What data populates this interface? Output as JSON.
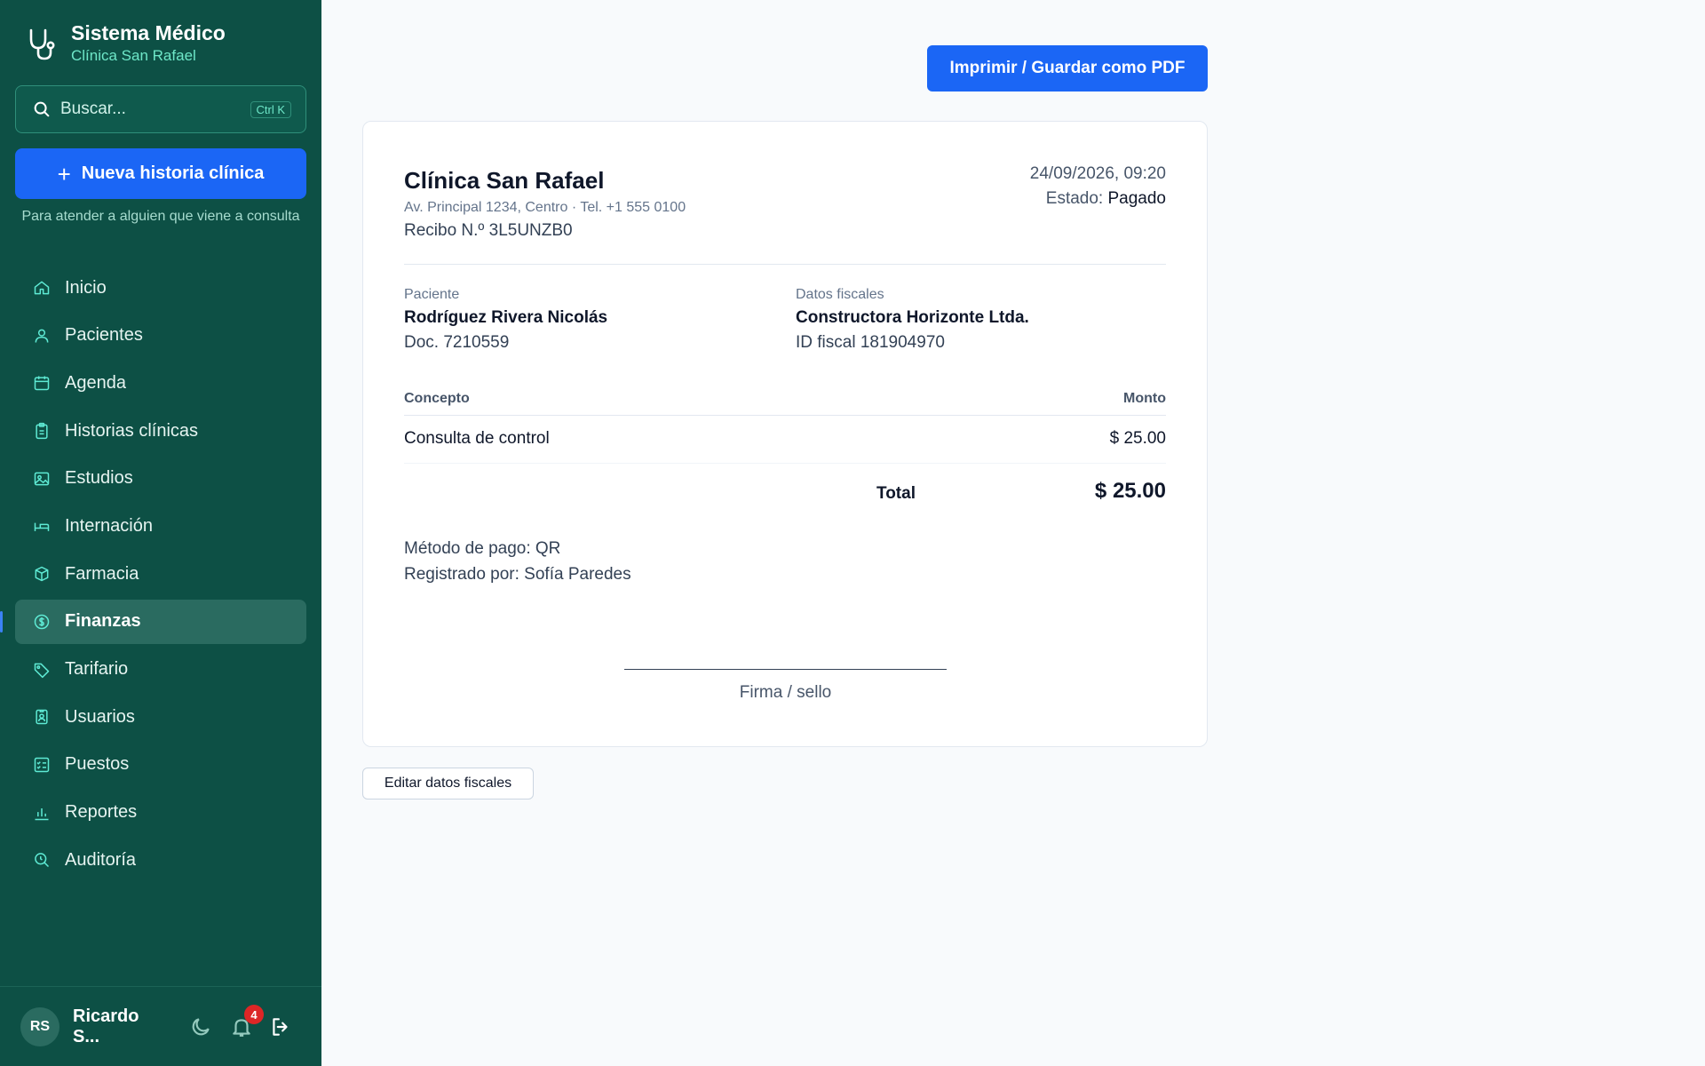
{
  "brand": {
    "title": "Sistema Médico",
    "subtitle": "Clínica San Rafael"
  },
  "search": {
    "placeholder": "Buscar...",
    "shortcut": "Ctrl K"
  },
  "new_record": {
    "label": "Nueva historia clínica",
    "plus": "+",
    "hint": "Para atender a alguien que viene a consulta"
  },
  "nav": [
    {
      "label": "Inicio",
      "icon": "home-icon"
    },
    {
      "label": "Pacientes",
      "icon": "user-icon"
    },
    {
      "label": "Agenda",
      "icon": "calendar-icon"
    },
    {
      "label": "Historias clínicas",
      "icon": "clipboard-icon"
    },
    {
      "label": "Estudios",
      "icon": "image-icon"
    },
    {
      "label": "Internación",
      "icon": "bed-icon"
    },
    {
      "label": "Farmacia",
      "icon": "package-icon"
    },
    {
      "label": "Finanzas",
      "icon": "dollar-icon",
      "active": true
    },
    {
      "label": "Tarifario",
      "icon": "tag-icon"
    },
    {
      "label": "Usuarios",
      "icon": "id-badge-icon"
    },
    {
      "label": "Puestos",
      "icon": "list-checks-icon"
    },
    {
      "label": "Reportes",
      "icon": "bar-chart-icon"
    },
    {
      "label": "Auditoría",
      "icon": "search-audit-icon"
    }
  ],
  "user": {
    "initials": "RS",
    "name": "Ricardo S...",
    "notifications": "4"
  },
  "print_button": "Imprimir / Guardar como PDF",
  "receipt": {
    "clinic_name": "Clínica San Rafael",
    "clinic_address": "Av. Principal 1234, Centro · Tel. +1 555 0100",
    "receipt_number": "Recibo N.º 3L5UNZB0",
    "datetime": "24/09/2026, 09:20",
    "status_label": "Estado:",
    "status_value": "Pagado",
    "patient_label": "Paciente",
    "patient_name": "Rodríguez Rivera Nicolás",
    "patient_doc": "Doc. 7210559",
    "fiscal_label": "Datos fiscales",
    "fiscal_name": "Constructora Horizonte Ltda.",
    "fiscal_id": "ID fiscal 181904970",
    "col_concept": "Concepto",
    "col_amount": "Monto",
    "items": [
      {
        "concept": "Consulta de control",
        "amount": "$ 25.00"
      }
    ],
    "total_label": "Total",
    "total_value": "$ 25.00",
    "payment_method": "Método de pago: QR",
    "registered_by": "Registrado por: Sofía Paredes",
    "signature_label": "Firma / sello"
  },
  "edit_fiscal_button": "Editar datos fiscales",
  "colors": {
    "sidebar": "#0d5045",
    "accent": "#1b66f5",
    "active_nav": "#2a6b60",
    "badge": "#dc2626"
  }
}
